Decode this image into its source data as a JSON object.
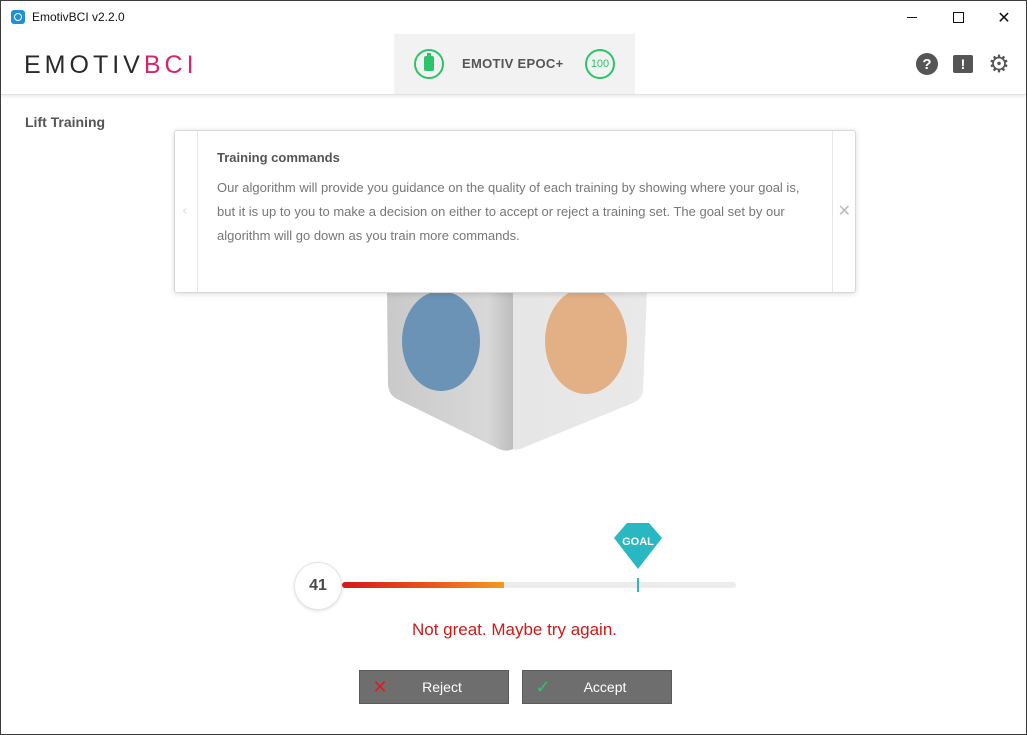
{
  "window": {
    "title": "EmotivBCI v2.2.0"
  },
  "header": {
    "logo_part1": "EMOTIV",
    "logo_part2": "BCI",
    "device_name": "EMOTIV EPOC+",
    "signal_quality": "100",
    "icons": [
      "help-icon",
      "alert-icon",
      "gear-icon"
    ],
    "battery_icon": "battery-icon"
  },
  "page": {
    "title": "Lift Training"
  },
  "tooltip": {
    "title": "Training commands",
    "body": "Our algorithm will provide you guidance on the quality of each training by showing where your goal is, but it is up to you to make a decision on either to accept or reject a training set.  The goal set by our algorithm will go down as you train more commands."
  },
  "training": {
    "score": "41",
    "score_fraction": 0.41,
    "goal_label": "GOAL",
    "goal_fraction": 0.75,
    "feedback": "Not great. Maybe try again."
  },
  "buttons": {
    "reject": "Reject",
    "accept": "Accept"
  },
  "colors": {
    "brand_pink": "#d6256d",
    "status_green": "#2cc46b",
    "goal_teal": "#29b7c2",
    "feedback_red": "#d01818",
    "button_gray": "#6e6e6e"
  }
}
